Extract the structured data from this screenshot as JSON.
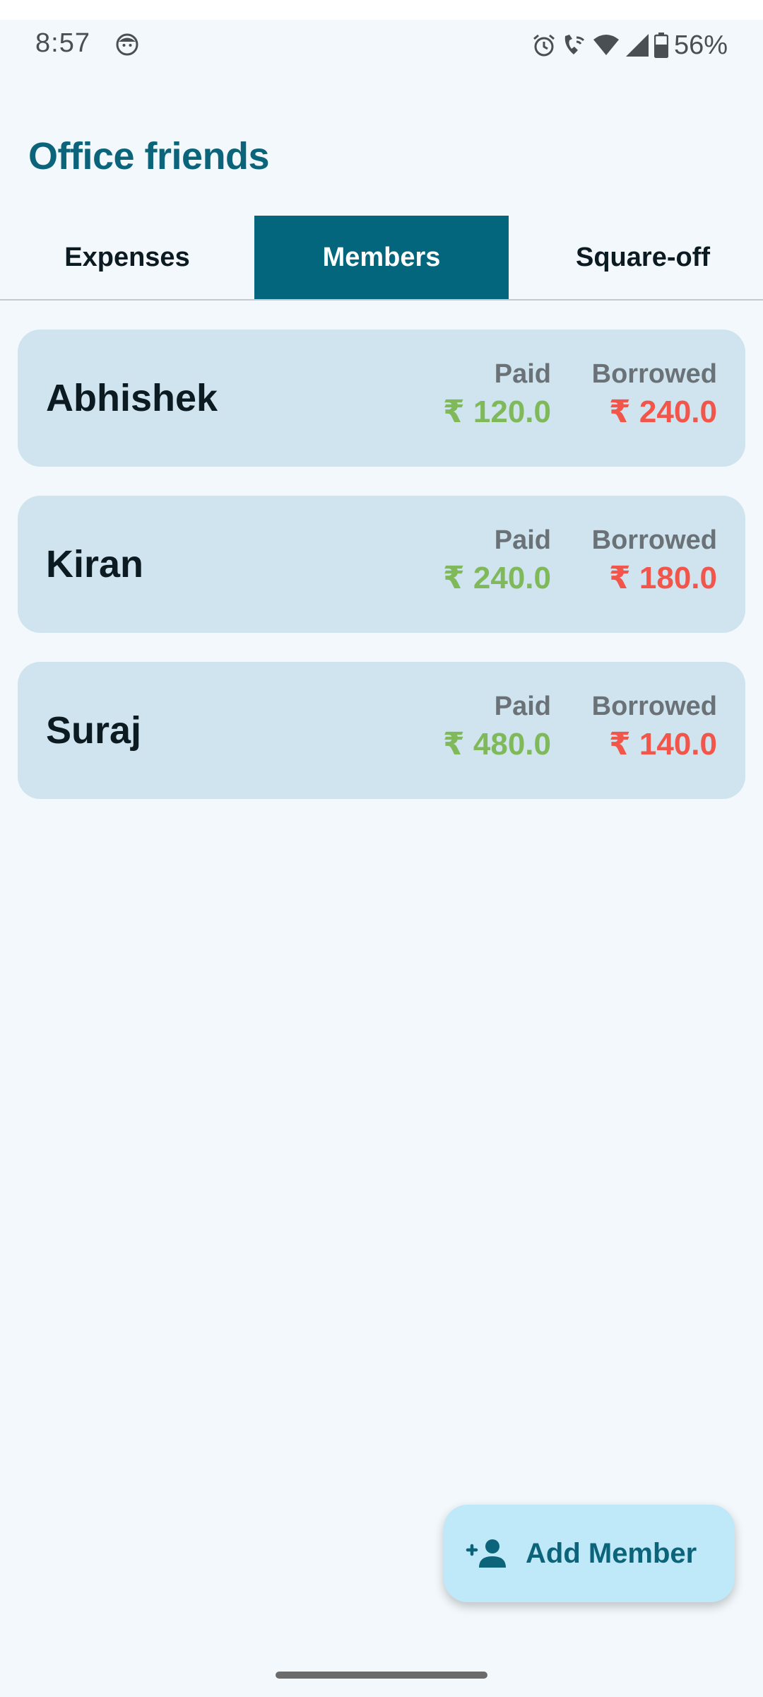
{
  "status_bar": {
    "time": "8:57",
    "icons": [
      "face-icon",
      "alarm-icon",
      "wifi-call-icon",
      "wifi-icon",
      "signal-icon",
      "battery-icon"
    ],
    "battery": "56%"
  },
  "header": {
    "title": "Office friends"
  },
  "tabs": [
    {
      "label": "Expenses",
      "active": false
    },
    {
      "label": "Members",
      "active": true
    },
    {
      "label": "Square-off",
      "active": false
    }
  ],
  "members": [
    {
      "name": "Abhishek",
      "paid_label": "Paid",
      "borrowed_label": "Borrowed",
      "paid": "₹ 120.0",
      "borrowed": "₹ 240.0"
    },
    {
      "name": "Kiran",
      "paid_label": "Paid",
      "borrowed_label": "Borrowed",
      "paid": "₹ 240.0",
      "borrowed": "₹ 180.0"
    },
    {
      "name": "Suraj",
      "paid_label": "Paid",
      "borrowed_label": "Borrowed",
      "paid": "₹ 480.0",
      "borrowed": "₹ 140.0"
    }
  ],
  "fab": {
    "label": "Add Member",
    "icon": "add-person-icon"
  },
  "colors": {
    "accent": "#03667d",
    "title": "#0b6479",
    "paid": "#7fb95a",
    "borrowed": "#f2554a",
    "card_bg": "#cfe4ee",
    "fab_bg": "#bfe8f8",
    "page_bg": "#f2f8fb"
  }
}
